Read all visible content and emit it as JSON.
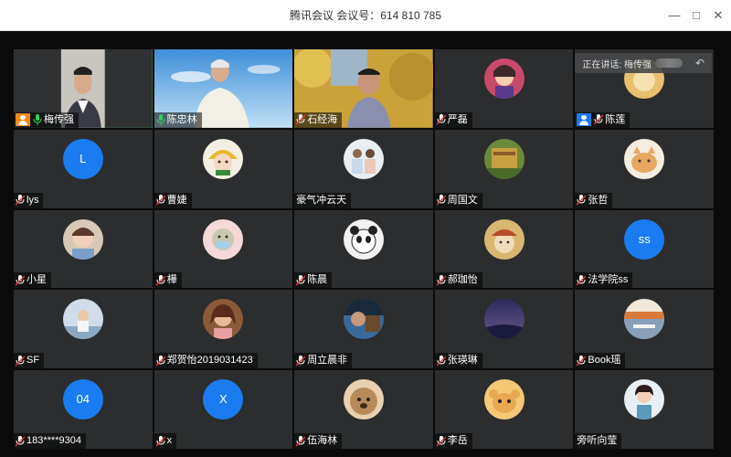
{
  "window": {
    "title": "腾讯会议 会议号：614 810 785",
    "minimize_icon": "minimize-icon",
    "maximize_icon": "maximize-icon",
    "close_icon": "close-icon"
  },
  "speaking_indicator": {
    "label": "正在讲话: 梅传强"
  },
  "participants": [
    {
      "name": "梅传强",
      "tile": "video",
      "badge": "orange"
    },
    {
      "name": "陈忠林",
      "tile": "video"
    },
    {
      "name": "石经海",
      "tile": "video"
    },
    {
      "name": "严磊",
      "tile": "avatar"
    },
    {
      "name": "陈莲",
      "tile": "avatar",
      "badge": "blue"
    },
    {
      "name": "lys",
      "tile": "letter",
      "letter": "L"
    },
    {
      "name": "曹婕",
      "tile": "avatar"
    },
    {
      "name": "豪气冲云天",
      "tile": "avatar"
    },
    {
      "name": "周国文",
      "tile": "avatar"
    },
    {
      "name": "张哲",
      "tile": "avatar"
    },
    {
      "name": "小星",
      "tile": "avatar"
    },
    {
      "name": "樺",
      "tile": "avatar"
    },
    {
      "name": "陈晨",
      "tile": "avatar"
    },
    {
      "name": "郝珈怡",
      "tile": "avatar"
    },
    {
      "name": "法学院ss",
      "tile": "letter",
      "letter": "ss"
    },
    {
      "name": "SF",
      "tile": "avatar"
    },
    {
      "name": "郑贺怡2019031423",
      "tile": "avatar"
    },
    {
      "name": "周立晨非",
      "tile": "avatar"
    },
    {
      "name": "张瑛琳",
      "tile": "avatar"
    },
    {
      "name": "Book瑶",
      "tile": "avatar"
    },
    {
      "name": "183****9304",
      "tile": "letter",
      "letter": "04"
    },
    {
      "name": "x",
      "tile": "letter",
      "letter": "X"
    },
    {
      "name": "伍海林",
      "tile": "avatar"
    },
    {
      "name": "李岳",
      "tile": "avatar"
    },
    {
      "name": "旁听向莹",
      "tile": "avatar"
    }
  ],
  "colors": {
    "tile_bg": "#2b2d2e",
    "stage_bg": "#0b0b0c",
    "letter_avatar": "#1a7cf0",
    "active_speaker_outline": "#2faa4f",
    "host_badge": "#f08a1c"
  }
}
